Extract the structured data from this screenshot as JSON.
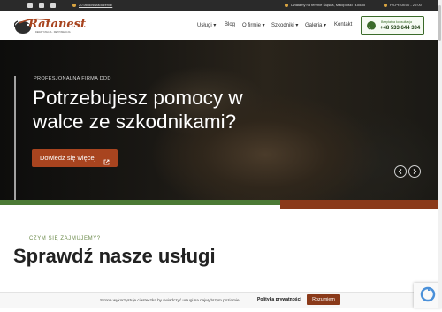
{
  "topbar": {
    "promo_link": "20 lat doświadczenia!",
    "area_text": "Działamy na terenie Śląska, Małopolski i Łódzki",
    "hours_text": "Pn-Pt: 08:00 - 20:00"
  },
  "header": {
    "logo_text": "Ratanest",
    "logo_tagline": "DERATYZACJA · DEZYNSEKCJA",
    "nav": [
      {
        "label": "Usługi ▾"
      },
      {
        "label": "Blog"
      },
      {
        "label": "O firmie ▾"
      },
      {
        "label": "Szkodniki ▾"
      },
      {
        "label": "Galeria ▾"
      },
      {
        "label": "Kontakt"
      }
    ],
    "cta_small": "Bezpłatna konsultacja",
    "cta_phone": "+48 533 644 334"
  },
  "hero": {
    "kicker": "PROFESJONALNA FIRMA DDD",
    "title": "Potrzebujesz pomocy w walce ze szkodnikami?",
    "button_label": "Dowiedz się więcej"
  },
  "services": {
    "kicker": "CZYM SIĘ ZAJMUJEMY?",
    "heading": "Sprawdź nasze usługi"
  },
  "cookie": {
    "message": "Strona wykorzystuje ciasteczka by świadczyć usługi na najwyższym poziomie.",
    "policy_link": "Polityka prywatności",
    "accept_label": "Rozumiem"
  },
  "colors": {
    "brand_brown": "#a8441f",
    "brand_green": "#4b7a35"
  }
}
